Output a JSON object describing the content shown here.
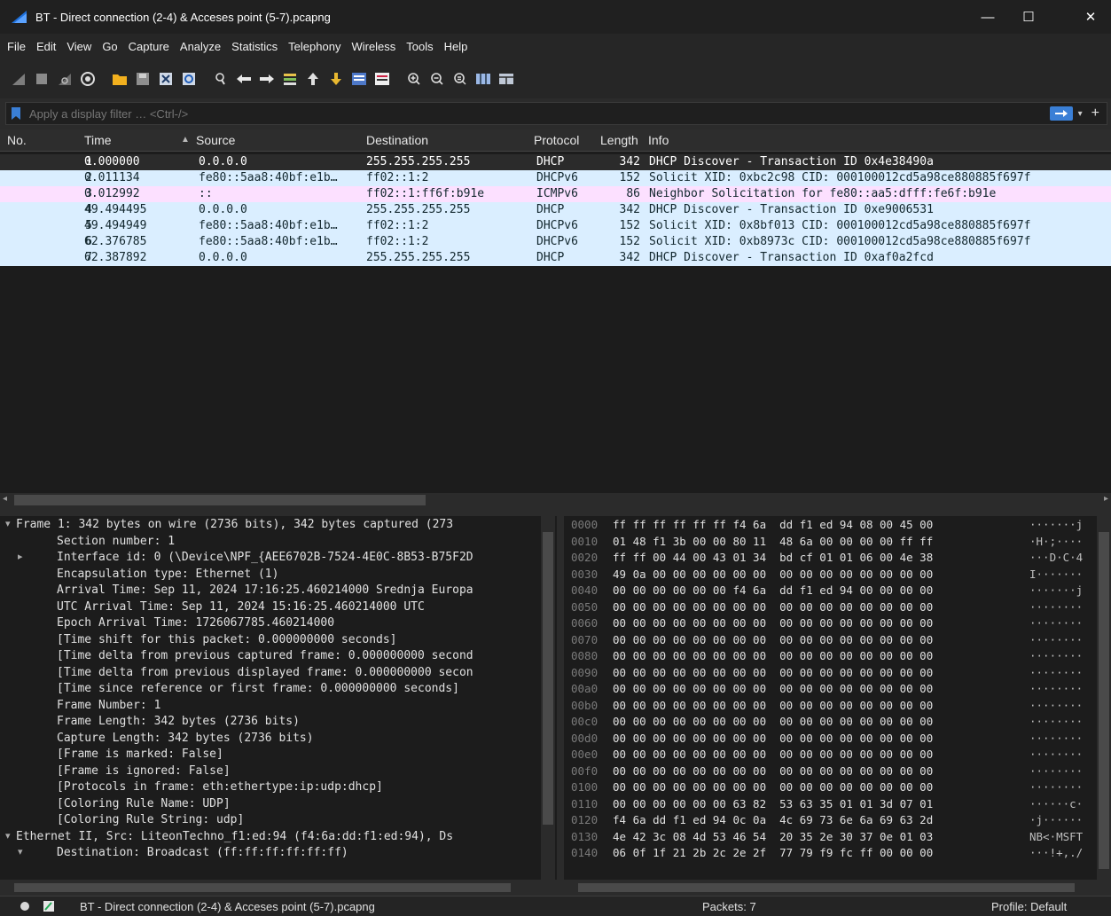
{
  "window": {
    "title": "BT - Direct connection (2-4) & Acceses point (5-7).pcapng",
    "minimize": "—",
    "maximize": "☐",
    "close": "✕"
  },
  "menu": [
    "File",
    "Edit",
    "View",
    "Go",
    "Capture",
    "Analyze",
    "Statistics",
    "Telephony",
    "Wireless",
    "Tools",
    "Help"
  ],
  "filter": {
    "placeholder": "Apply a display filter … <Ctrl-/>",
    "add": "+"
  },
  "packet_list": {
    "columns": [
      "No.",
      "Time",
      "Source",
      "Destination",
      "Protocol",
      "Length",
      "Info"
    ],
    "rows": [
      {
        "no": "1",
        "time": "0.000000",
        "source": "0.0.0.0",
        "destination": "255.255.255.255",
        "protocol": "DHCP",
        "length": "342",
        "info": "DHCP Discover - Transaction ID 0x4e38490a",
        "color": "#2b2b2b",
        "text": "#ffffff"
      },
      {
        "no": "2",
        "time": "0.011134",
        "source": "fe80::5aa8:40bf:e1b…",
        "destination": "ff02::1:2",
        "protocol": "DHCPv6",
        "length": "152",
        "info": "Solicit XID: 0xbc2c98 CID: 000100012cd5a98ce880885f697f",
        "color": "#daeeff",
        "text": "#12272e"
      },
      {
        "no": "3",
        "time": "0.012992",
        "source": "::",
        "destination": "ff02::1:ff6f:b91e",
        "protocol": "ICMPv6",
        "length": "86",
        "info": "Neighbor Solicitation for fe80::aa5:dfff:fe6f:b91e",
        "color": "#fce0ff",
        "text": "#12272e"
      },
      {
        "no": "4",
        "time": "49.494495",
        "source": "0.0.0.0",
        "destination": "255.255.255.255",
        "protocol": "DHCP",
        "length": "342",
        "info": "DHCP Discover - Transaction ID 0xe9006531",
        "color": "#daeeff",
        "text": "#12272e"
      },
      {
        "no": "5",
        "time": "49.494949",
        "source": "fe80::5aa8:40bf:e1b…",
        "destination": "ff02::1:2",
        "protocol": "DHCPv6",
        "length": "152",
        "info": "Solicit XID: 0x8bf013 CID: 000100012cd5a98ce880885f697f",
        "color": "#daeeff",
        "text": "#12272e"
      },
      {
        "no": "6",
        "time": "62.376785",
        "source": "fe80::5aa8:40bf:e1b…",
        "destination": "ff02::1:2",
        "protocol": "DHCPv6",
        "length": "152",
        "info": "Solicit XID: 0xb8973c CID: 000100012cd5a98ce880885f697f",
        "color": "#daeeff",
        "text": "#12272e"
      },
      {
        "no": "7",
        "time": "62.387892",
        "source": "0.0.0.0",
        "destination": "255.255.255.255",
        "protocol": "DHCP",
        "length": "342",
        "info": "DHCP Discover - Transaction ID 0xaf0a2fcd",
        "color": "#daeeff",
        "text": "#12272e"
      }
    ]
  },
  "details": [
    {
      "indent": 0,
      "arrow": "▾",
      "text": "Frame 1: 342 bytes on wire (2736 bits), 342 bytes captured (273"
    },
    {
      "indent": 1,
      "arrow": "",
      "text": "Section number: 1"
    },
    {
      "indent": 1,
      "arrow": "▸",
      "text": "Interface id: 0 (\\Device\\NPF_{AEE6702B-7524-4E0C-8B53-B75F2D"
    },
    {
      "indent": 1,
      "arrow": "",
      "text": "Encapsulation type: Ethernet (1)"
    },
    {
      "indent": 1,
      "arrow": "",
      "text": "Arrival Time: Sep 11, 2024 17:16:25.460214000 Srednja Europa"
    },
    {
      "indent": 1,
      "arrow": "",
      "text": "UTC Arrival Time: Sep 11, 2024 15:16:25.460214000 UTC"
    },
    {
      "indent": 1,
      "arrow": "",
      "text": "Epoch Arrival Time: 1726067785.460214000"
    },
    {
      "indent": 1,
      "arrow": "",
      "text": "[Time shift for this packet: 0.000000000 seconds]"
    },
    {
      "indent": 1,
      "arrow": "",
      "text": "[Time delta from previous captured frame: 0.000000000 second"
    },
    {
      "indent": 1,
      "arrow": "",
      "text": "[Time delta from previous displayed frame: 0.000000000 secon"
    },
    {
      "indent": 1,
      "arrow": "",
      "text": "[Time since reference or first frame: 0.000000000 seconds]"
    },
    {
      "indent": 1,
      "arrow": "",
      "text": "Frame Number: 1"
    },
    {
      "indent": 1,
      "arrow": "",
      "text": "Frame Length: 342 bytes (2736 bits)"
    },
    {
      "indent": 1,
      "arrow": "",
      "text": "Capture Length: 342 bytes (2736 bits)"
    },
    {
      "indent": 1,
      "arrow": "",
      "text": "[Frame is marked: False]"
    },
    {
      "indent": 1,
      "arrow": "",
      "text": "[Frame is ignored: False]"
    },
    {
      "indent": 1,
      "arrow": "",
      "text": "[Protocols in frame: eth:ethertype:ip:udp:dhcp]"
    },
    {
      "indent": 1,
      "arrow": "",
      "text": "[Coloring Rule Name: UDP]"
    },
    {
      "indent": 1,
      "arrow": "",
      "text": "[Coloring Rule String: udp]"
    },
    {
      "indent": 0,
      "arrow": "▾",
      "text": "Ethernet II, Src: LiteonTechno_f1:ed:94 (f4:6a:dd:f1:ed:94), Ds"
    },
    {
      "indent": 1,
      "arrow": "▾",
      "text": "Destination: Broadcast (ff:ff:ff:ff:ff:ff)"
    }
  ],
  "bytes": [
    {
      "off": "0000",
      "hex": "ff ff ff ff ff ff f4 6a  dd f1 ed 94 08 00 45 00",
      "asc": "·······j"
    },
    {
      "off": "0010",
      "hex": "01 48 f1 3b 00 00 80 11  48 6a 00 00 00 00 ff ff",
      "asc": "·H·;····"
    },
    {
      "off": "0020",
      "hex": "ff ff 00 44 00 43 01 34  bd cf 01 01 06 00 4e 38",
      "asc": "···D·C·4"
    },
    {
      "off": "0030",
      "hex": "49 0a 00 00 00 00 00 00  00 00 00 00 00 00 00 00",
      "asc": "I·······"
    },
    {
      "off": "0040",
      "hex": "00 00 00 00 00 00 f4 6a  dd f1 ed 94 00 00 00 00",
      "asc": "·······j"
    },
    {
      "off": "0050",
      "hex": "00 00 00 00 00 00 00 00  00 00 00 00 00 00 00 00",
      "asc": "········"
    },
    {
      "off": "0060",
      "hex": "00 00 00 00 00 00 00 00  00 00 00 00 00 00 00 00",
      "asc": "········"
    },
    {
      "off": "0070",
      "hex": "00 00 00 00 00 00 00 00  00 00 00 00 00 00 00 00",
      "asc": "········"
    },
    {
      "off": "0080",
      "hex": "00 00 00 00 00 00 00 00  00 00 00 00 00 00 00 00",
      "asc": "········"
    },
    {
      "off": "0090",
      "hex": "00 00 00 00 00 00 00 00  00 00 00 00 00 00 00 00",
      "asc": "········"
    },
    {
      "off": "00a0",
      "hex": "00 00 00 00 00 00 00 00  00 00 00 00 00 00 00 00",
      "asc": "········"
    },
    {
      "off": "00b0",
      "hex": "00 00 00 00 00 00 00 00  00 00 00 00 00 00 00 00",
      "asc": "········"
    },
    {
      "off": "00c0",
      "hex": "00 00 00 00 00 00 00 00  00 00 00 00 00 00 00 00",
      "asc": "········"
    },
    {
      "off": "00d0",
      "hex": "00 00 00 00 00 00 00 00  00 00 00 00 00 00 00 00",
      "asc": "········"
    },
    {
      "off": "00e0",
      "hex": "00 00 00 00 00 00 00 00  00 00 00 00 00 00 00 00",
      "asc": "········"
    },
    {
      "off": "00f0",
      "hex": "00 00 00 00 00 00 00 00  00 00 00 00 00 00 00 00",
      "asc": "········"
    },
    {
      "off": "0100",
      "hex": "00 00 00 00 00 00 00 00  00 00 00 00 00 00 00 00",
      "asc": "········"
    },
    {
      "off": "0110",
      "hex": "00 00 00 00 00 00 63 82  53 63 35 01 01 3d 07 01",
      "asc": "······c·"
    },
    {
      "off": "0120",
      "hex": "f4 6a dd f1 ed 94 0c 0a  4c 69 73 6e 6a 69 63 2d",
      "asc": "·j······"
    },
    {
      "off": "0130",
      "hex": "4e 42 3c 08 4d 53 46 54  20 35 2e 30 37 0e 01 03",
      "asc": "NB<·MSFT"
    },
    {
      "off": "0140",
      "hex": "06 0f 1f 21 2b 2c 2e 2f  77 79 f9 fc ff 00 00 00",
      "asc": "···!+,./"
    }
  ],
  "status": {
    "file": "BT - Direct connection (2-4) & Acceses point (5-7).pcapng",
    "packets": "Packets: 7",
    "profile": "Profile: Default"
  },
  "colors": {
    "accent": "#3a7fd6",
    "selected_row": "#2b2b2b",
    "udp_row": "#daeeff",
    "icmp_row": "#fce0ff"
  }
}
